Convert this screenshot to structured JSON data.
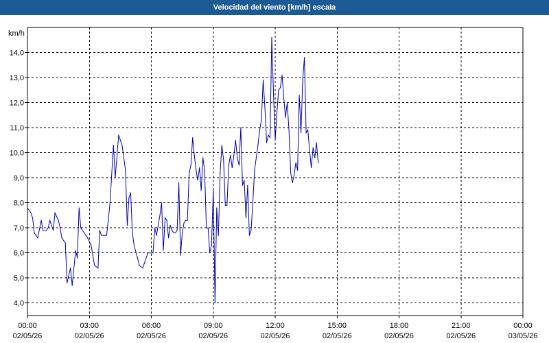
{
  "title": "Velocidad del viento [km/h] escala",
  "chart_data": {
    "type": "line",
    "title": "Velocidad del viento [km/h] escala",
    "ylabel": "km/h",
    "xlabel": "",
    "ylim": [
      3.5,
      15.0
    ],
    "xlim": [
      "02/05/26 00:00",
      "03/05/26 00:00"
    ],
    "grid": true,
    "y_ticks": [
      "4,0",
      "5,0",
      "6,0",
      "7,0",
      "8,0",
      "9,0",
      "10,0",
      "11,0",
      "12,0",
      "13,0",
      "14,0"
    ],
    "x_ticks": [
      {
        "time": "00:00",
        "date": "02/05/26"
      },
      {
        "time": "03:00",
        "date": "02/05/26"
      },
      {
        "time": "06:00",
        "date": "02/05/26"
      },
      {
        "time": "09:00",
        "date": "02/05/26"
      },
      {
        "time": "12:00",
        "date": "02/05/26"
      },
      {
        "time": "15:00",
        "date": "02/05/26"
      },
      {
        "time": "18:00",
        "date": "02/05/26"
      },
      {
        "time": "21:00",
        "date": "02/05/26"
      },
      {
        "time": "00:00",
        "date": "03/05/26"
      }
    ],
    "series": [
      {
        "color": "#0000aa",
        "points": [
          [
            "00:00",
            7.8
          ],
          [
            "00:10",
            7.6
          ],
          [
            "00:15",
            7.4
          ],
          [
            "00:20",
            6.8
          ],
          [
            "00:25",
            6.7
          ],
          [
            "00:30",
            6.6
          ],
          [
            "00:40",
            7.3
          ],
          [
            "00:45",
            6.9
          ],
          [
            "00:55",
            6.9
          ],
          [
            "01:00",
            7.0
          ],
          [
            "01:05",
            7.3
          ],
          [
            "01:15",
            6.9
          ],
          [
            "01:20",
            7.6
          ],
          [
            "01:30",
            7.3
          ],
          [
            "01:35",
            7.0
          ],
          [
            "01:40",
            6.6
          ],
          [
            "01:45",
            6.5
          ],
          [
            "01:50",
            6.4
          ],
          [
            "01:55",
            4.8
          ],
          [
            "02:05",
            5.4
          ],
          [
            "02:10",
            4.7
          ],
          [
            "02:20",
            6.1
          ],
          [
            "02:25",
            5.8
          ],
          [
            "02:30",
            7.8
          ],
          [
            "02:35",
            7.0
          ],
          [
            "02:45",
            6.8
          ],
          [
            "02:55",
            6.6
          ],
          [
            "03:05",
            6.3
          ],
          [
            "03:10",
            5.9
          ],
          [
            "03:15",
            5.5
          ],
          [
            "03:25",
            5.4
          ],
          [
            "03:30",
            6.9
          ],
          [
            "03:35",
            6.7
          ],
          [
            "03:45",
            6.7
          ],
          [
            "03:50",
            6.7
          ],
          [
            "03:55",
            7.3
          ],
          [
            "04:00",
            8.0
          ],
          [
            "04:10",
            10.3
          ],
          [
            "04:15",
            9.0
          ],
          [
            "04:25",
            10.7
          ],
          [
            "04:30",
            10.5
          ],
          [
            "04:35",
            10.3
          ],
          [
            "04:45",
            9.3
          ],
          [
            "04:50",
            7.1
          ],
          [
            "04:55",
            8.2
          ],
          [
            "05:00",
            8.4
          ],
          [
            "05:05",
            6.8
          ],
          [
            "05:10",
            6.3
          ],
          [
            "05:20",
            5.8
          ],
          [
            "05:25",
            5.5
          ],
          [
            "05:35",
            5.4
          ],
          [
            "05:40",
            5.6
          ],
          [
            "05:50",
            6.0
          ],
          [
            "06:00",
            6.0
          ],
          [
            "06:05",
            6.0
          ],
          [
            "06:10",
            7.0
          ],
          [
            "06:15",
            6.7
          ],
          [
            "06:25",
            7.5
          ],
          [
            "06:30",
            8.0
          ],
          [
            "06:35",
            6.1
          ],
          [
            "06:40",
            7.4
          ],
          [
            "06:45",
            7.3
          ],
          [
            "06:50",
            6.6
          ],
          [
            "06:55",
            7.1
          ],
          [
            "07:00",
            6.9
          ],
          [
            "07:05",
            6.8
          ],
          [
            "07:10",
            6.8
          ],
          [
            "07:15",
            6.9
          ],
          [
            "07:20",
            8.8
          ],
          [
            "07:25",
            5.9
          ],
          [
            "07:30",
            6.8
          ],
          [
            "07:35",
            7.2
          ],
          [
            "07:40",
            7.3
          ],
          [
            "07:45",
            7.3
          ],
          [
            "07:50",
            9.2
          ],
          [
            "07:55",
            9.5
          ],
          [
            "08:00",
            10.6
          ],
          [
            "08:05",
            9.9
          ],
          [
            "08:10",
            9.3
          ],
          [
            "08:15",
            8.9
          ],
          [
            "08:20",
            9.4
          ],
          [
            "08:25",
            8.5
          ],
          [
            "08:30",
            9.8
          ],
          [
            "08:35",
            9.3
          ],
          [
            "08:40",
            7.0
          ],
          [
            "08:45",
            7.0
          ],
          [
            "08:50",
            6.0
          ],
          [
            "08:55",
            6.3
          ],
          [
            "09:00",
            8.5
          ],
          [
            "09:05",
            4.0
          ],
          [
            "09:10",
            7.8
          ],
          [
            "09:15",
            6.7
          ],
          [
            "09:20",
            9.2
          ],
          [
            "09:25",
            10.3
          ],
          [
            "09:30",
            9.7
          ],
          [
            "09:35",
            7.9
          ],
          [
            "09:40",
            7.9
          ],
          [
            "09:45",
            9.5
          ],
          [
            "09:50",
            9.9
          ],
          [
            "09:55",
            9.4
          ],
          [
            "10:00",
            9.9
          ],
          [
            "10:05",
            10.5
          ],
          [
            "10:10",
            9.8
          ],
          [
            "10:15",
            9.5
          ],
          [
            "10:20",
            11.0
          ],
          [
            "10:25",
            8.7
          ],
          [
            "10:30",
            8.9
          ],
          [
            "10:35",
            7.4
          ],
          [
            "10:40",
            8.7
          ],
          [
            "10:45",
            6.7
          ],
          [
            "10:50",
            6.9
          ],
          [
            "10:55",
            8.0
          ],
          [
            "11:00",
            9.3
          ],
          [
            "11:05",
            9.8
          ],
          [
            "11:10",
            10.3
          ],
          [
            "11:15",
            10.9
          ],
          [
            "11:20",
            11.3
          ],
          [
            "11:25",
            12.9
          ],
          [
            "11:30",
            11.8
          ],
          [
            "11:35",
            10.4
          ],
          [
            "11:40",
            10.7
          ],
          [
            "11:45",
            10.6
          ],
          [
            "11:50",
            14.6
          ],
          [
            "11:55",
            12.4
          ],
          [
            "12:00",
            10.5
          ],
          [
            "12:05",
            11.6
          ],
          [
            "12:10",
            12.5
          ],
          [
            "12:15",
            12.6
          ],
          [
            "12:20",
            13.1
          ],
          [
            "12:25",
            12.2
          ],
          [
            "12:30",
            11.4
          ],
          [
            "12:35",
            12.0
          ],
          [
            "12:40",
            10.9
          ],
          [
            "12:45",
            9.2
          ],
          [
            "12:50",
            8.8
          ],
          [
            "12:55",
            9.1
          ],
          [
            "13:00",
            9.6
          ],
          [
            "13:05",
            9.3
          ],
          [
            "13:10",
            12.3
          ],
          [
            "13:15",
            10.8
          ],
          [
            "13:20",
            12.9
          ],
          [
            "13:25",
            13.8
          ],
          [
            "13:30",
            10.8
          ],
          [
            "13:35",
            10.9
          ],
          [
            "13:40",
            10.1
          ],
          [
            "13:45",
            9.4
          ],
          [
            "13:50",
            10.2
          ],
          [
            "13:55",
            9.8
          ],
          [
            "14:00",
            10.4
          ],
          [
            "14:05",
            9.6
          ]
        ]
      }
    ]
  }
}
